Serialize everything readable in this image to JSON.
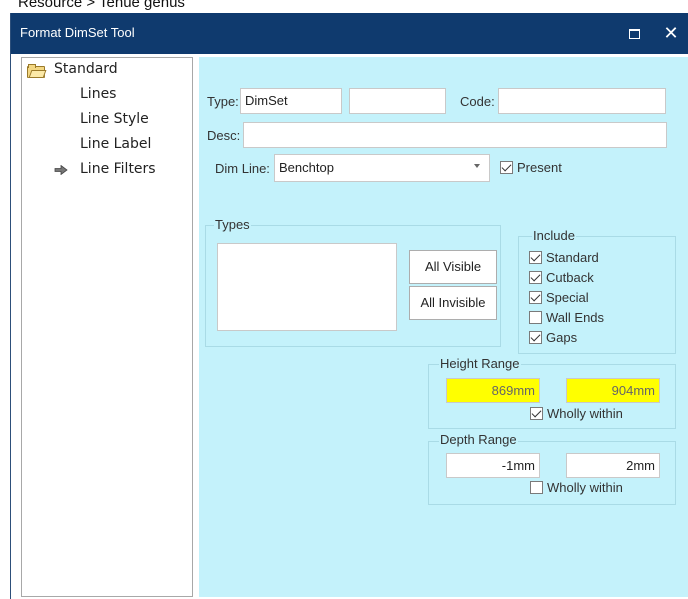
{
  "topcut_text": "Resource > Tenue genus",
  "window": {
    "title": "Format DimSet Tool",
    "maximize_icon": "maximize-icon",
    "close_glyph": "✕"
  },
  "tree": {
    "root": "Standard",
    "items": [
      "Lines",
      "Line Style",
      "Line Label",
      "Line Filters"
    ],
    "selected": "Line Filters"
  },
  "form": {
    "type_label": "Type:",
    "type_value": "DimSet",
    "type_extra_value": "",
    "code_label": "Code:",
    "code_value": "",
    "desc_label": "Desc:",
    "desc_value": "",
    "dimline_label": "Dim Line:",
    "dimline_value": "Benchtop",
    "present_label": "Present",
    "present_checked": true
  },
  "types": {
    "label": "Types",
    "all_visible": "All Visible",
    "all_invisible": "All Invisible"
  },
  "include": {
    "label": "Include",
    "options": [
      {
        "label": "Standard",
        "checked": true
      },
      {
        "label": "Cutback",
        "checked": true
      },
      {
        "label": "Special",
        "checked": true
      },
      {
        "label": "Wall Ends",
        "checked": false
      },
      {
        "label": "Gaps",
        "checked": true
      }
    ]
  },
  "height_range": {
    "label": "Height Range",
    "min": "869mm",
    "max": "904mm",
    "wholly_within": "Wholly within",
    "wholly_checked": true,
    "highlight_color": "#ffff00"
  },
  "depth_range": {
    "label": "Depth Range",
    "min": "-1mm",
    "max": "2mm",
    "wholly_within": "Wholly within",
    "wholly_checked": false
  },
  "colors": {
    "titlebar": "#0f3a6e",
    "panel": "#c4f2fb"
  }
}
